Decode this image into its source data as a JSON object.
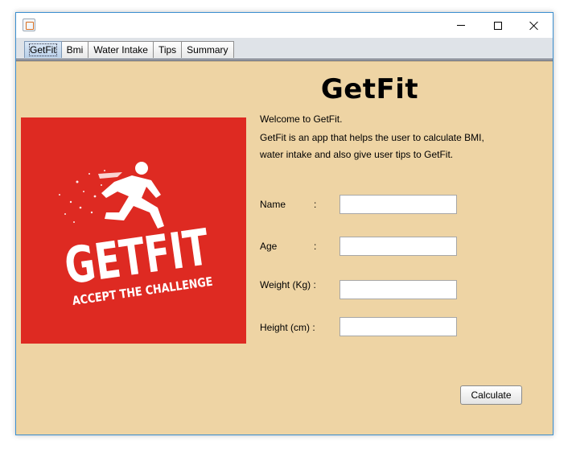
{
  "window": {
    "title": "",
    "controls": {
      "minimize": "minimize-icon",
      "maximize": "maximize-icon",
      "close": "close-icon"
    }
  },
  "tabs": [
    {
      "label": "GetFit",
      "selected": true
    },
    {
      "label": "Bmi",
      "selected": false
    },
    {
      "label": "Water Intake",
      "selected": false
    },
    {
      "label": "Tips",
      "selected": false
    },
    {
      "label": "Summary",
      "selected": false
    }
  ],
  "main": {
    "title": "GetFit",
    "welcome": "Welcome to GetFit.",
    "desc_line1": "GetFit is an app that helps the user to calculate BMI,",
    "desc_line2": "water intake and also give user tips to GetFit.",
    "logo": {
      "text_big": "GETFIT",
      "text_small": "ACCEPT THE CHALLENGE",
      "bg_color": "#de2a22"
    },
    "form": {
      "name": {
        "label": "Name",
        "colon": ":",
        "value": ""
      },
      "age": {
        "label": "Age",
        "colon": ":",
        "value": ""
      },
      "weight": {
        "label": "Weight (Kg) :",
        "value": ""
      },
      "height": {
        "label": "Height (cm) :",
        "value": ""
      }
    },
    "calculate_label": "Calculate"
  },
  "colors": {
    "panel_bg": "#eed4a4",
    "accent_border": "#3b8fd0"
  }
}
